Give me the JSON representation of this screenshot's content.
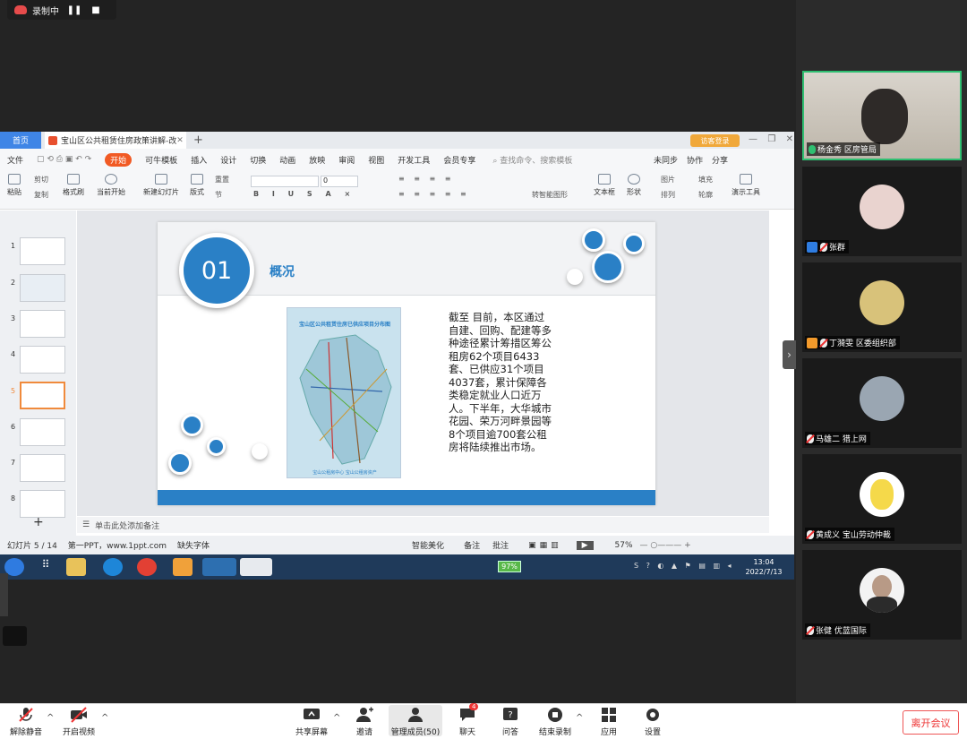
{
  "recording": {
    "label": "录制中"
  },
  "app": {
    "home_tab": "首页",
    "doc_tab": "宝山区公共租赁住房政策讲解-改",
    "visitor_login": "访客登录",
    "menu": [
      "文件",
      "开始",
      "可牛模板",
      "插入",
      "设计",
      "切换",
      "动画",
      "放映",
      "审阅",
      "视图",
      "开发工具",
      "会员专享"
    ],
    "search_placeholder": "查找命令、搜索模板",
    "menu_right": [
      "未同步",
      "协作",
      "分享"
    ],
    "ribbon": {
      "paste": "粘贴",
      "cut": "剪切",
      "copy": "复制",
      "format_painter": "格式刷",
      "from_start": "当前开始",
      "new_slide": "新建幻灯片",
      "layout": "版式",
      "section": "节",
      "reset": "重置",
      "font_size": "0",
      "smart_shape": "转智能图形",
      "textbox": "文本框",
      "shape": "形状",
      "arrange": "排列",
      "picture": "图片",
      "fill": "填充",
      "outline": "轮廓",
      "present_tools": "演示工具"
    },
    "thumbnails": [
      "1",
      "2",
      "3",
      "4",
      "5",
      "6",
      "7",
      "8"
    ],
    "selected_thumb": "5",
    "add_note": "单击此处添加备注",
    "status": {
      "slide_pos": "幻灯片 5 / 14",
      "theme": "第一PPT，www.1ppt.com",
      "missing_font": "缺失字体",
      "smart_beautify": "智能美化",
      "notes": "备注",
      "comments": "批注",
      "zoom": "57%"
    }
  },
  "slide": {
    "number": "01",
    "title": "概况",
    "map_title": "宝山区公共租赁住房已供应项目分布图",
    "map_footer": "宝山公租房中心    宝山公租房资产",
    "body": "截至 目前，本区通过自建、回购、配建等多种途径累计筹措区筹公租房62个项目6433套、已供应31个项目 4037套，累计保障各类稳定就业人口近万人。下半年，大华城市花园、荣万河畔景园等8个项目逾700套公租房将陆续推出市场。"
  },
  "taskbar": {
    "battery": "97%",
    "time": "13:04",
    "date": "2022/7/13"
  },
  "participants": [
    {
      "name": "杨金秀 区房管局",
      "muted": false,
      "active": true,
      "avatar_color": "#c8c2b8"
    },
    {
      "name": "张群",
      "muted": true,
      "host_icon": "#2f7de1",
      "avatar_color": "#e9d3cf"
    },
    {
      "name": "丁漪雯 区委组织部",
      "muted": true,
      "host_icon": "#f39a2b",
      "avatar_color": "#d8c27a"
    },
    {
      "name": "马雄二 猎上网",
      "muted": true,
      "avatar_color": "#9aa6b2"
    },
    {
      "name": "黄成义 宝山劳动仲裁",
      "muted": true,
      "avatar_color": "#f5d94a"
    },
    {
      "name": "张健 优蓝国际",
      "muted": true,
      "avatar_color": "#b89a86"
    }
  ],
  "toolbar": {
    "unmute": "解除静音",
    "start_video": "开启视频",
    "share_screen": "共享屏幕",
    "invite": "邀请",
    "manage_members": "管理成员(50)",
    "chat": "聊天",
    "chat_badge": "4",
    "qa": "问答",
    "stop_recording": "结束录制",
    "apps": "应用",
    "settings": "设置",
    "leave": "离开会议"
  }
}
